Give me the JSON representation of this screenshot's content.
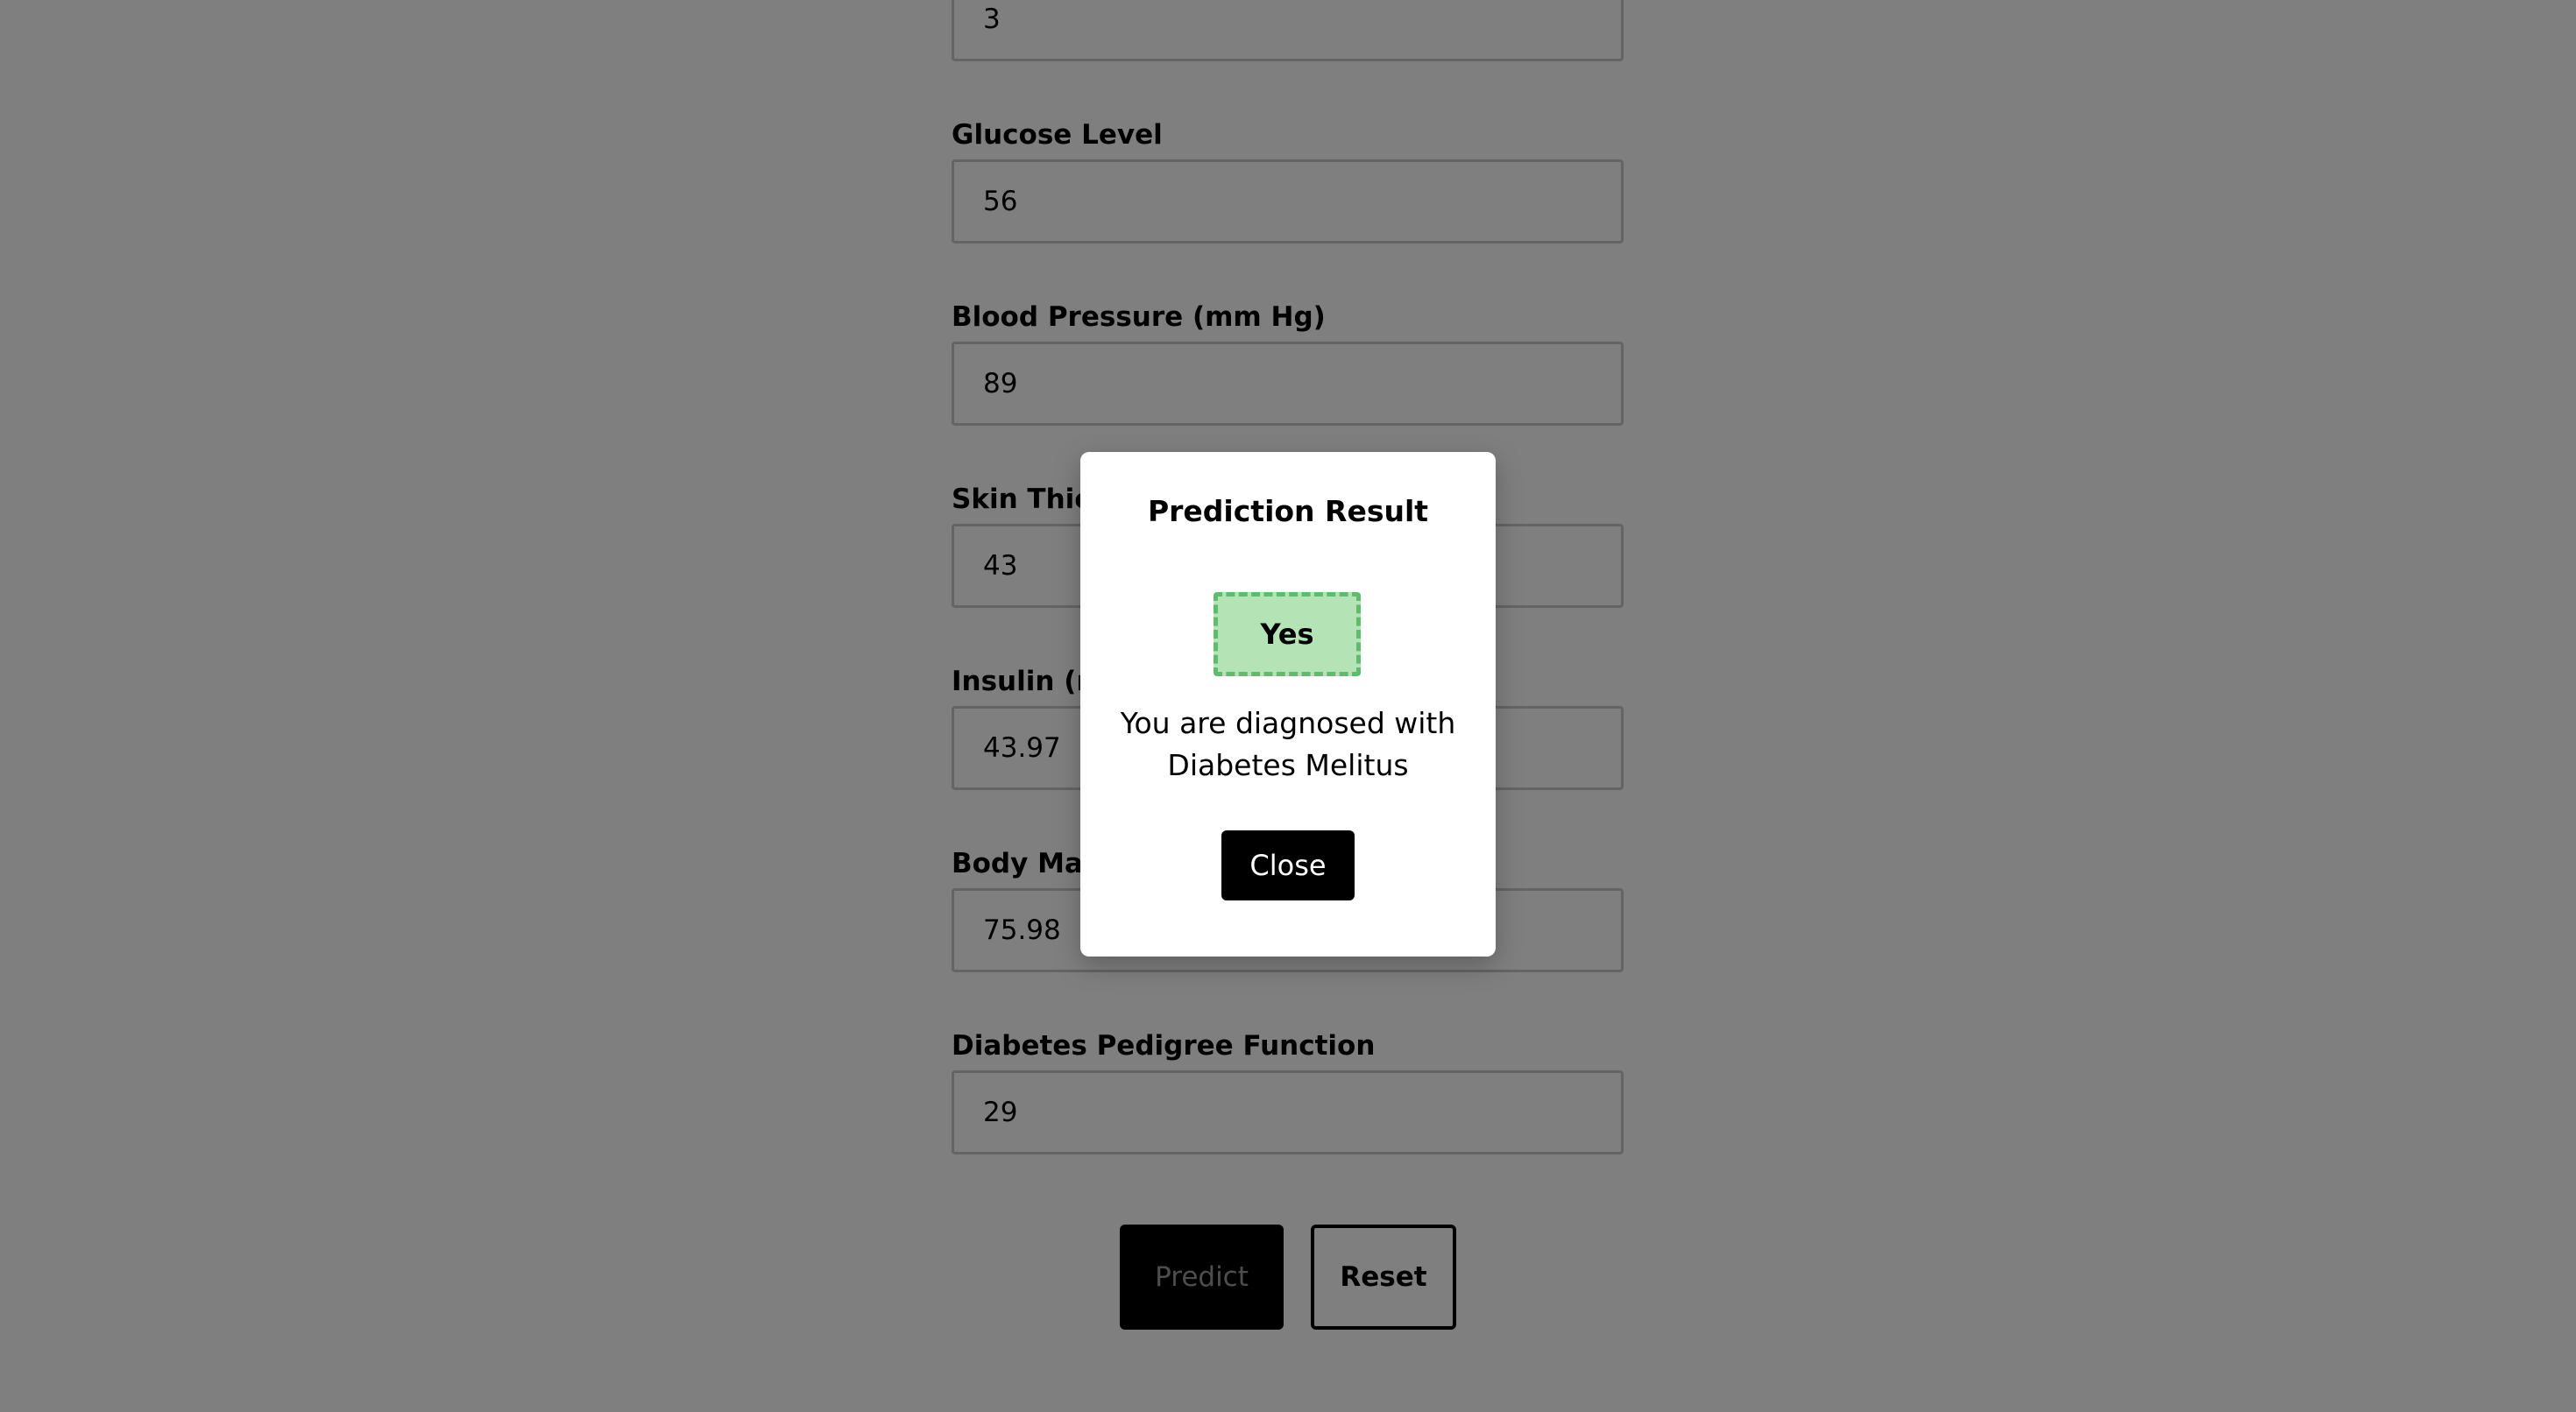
{
  "form": {
    "fields": [
      {
        "label": "",
        "value": "3"
      },
      {
        "label": "Glucose Level",
        "value": "56"
      },
      {
        "label": "Blood Pressure (mm Hg)",
        "value": "89"
      },
      {
        "label": "Skin Thic",
        "value": "43"
      },
      {
        "label": "Insulin (n",
        "value": "43.97"
      },
      {
        "label": "Body Mas",
        "value": "75.98"
      },
      {
        "label": "Diabetes Pedigree Function",
        "value": "29"
      }
    ],
    "predict_label": "Predict",
    "reset_label": "Reset"
  },
  "modal": {
    "title": "Prediction Result",
    "result": "Yes",
    "message": "You are diagnosed with Diabetes Melitus",
    "close_label": "Close"
  },
  "colors": {
    "overlay": "rgba(0,0,0,0.5)",
    "result_background": "#b4e4b6",
    "result_border": "#5cbd6b"
  }
}
